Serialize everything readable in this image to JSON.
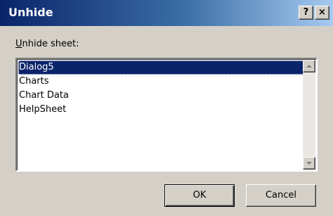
{
  "window": {
    "title": "Unhide",
    "help_glyph": "?",
    "close_glyph": "×"
  },
  "list_label": {
    "accel": "U",
    "rest": "nhide sheet:"
  },
  "sheets": [
    "Dialog5",
    "Charts",
    "Chart Data",
    "HelpSheet"
  ],
  "selected_index": 0,
  "buttons": {
    "ok": "OK",
    "cancel": "Cancel"
  },
  "colors": {
    "titlebar_start": "#0a246a",
    "titlebar_end": "#a6caf0",
    "selection": "#0a246a",
    "face": "#d4d0c8"
  },
  "icons": {
    "help": "help-icon",
    "close": "close-icon",
    "scroll_up": "scroll-up-arrow-icon",
    "scroll_down": "scroll-down-arrow-icon"
  }
}
